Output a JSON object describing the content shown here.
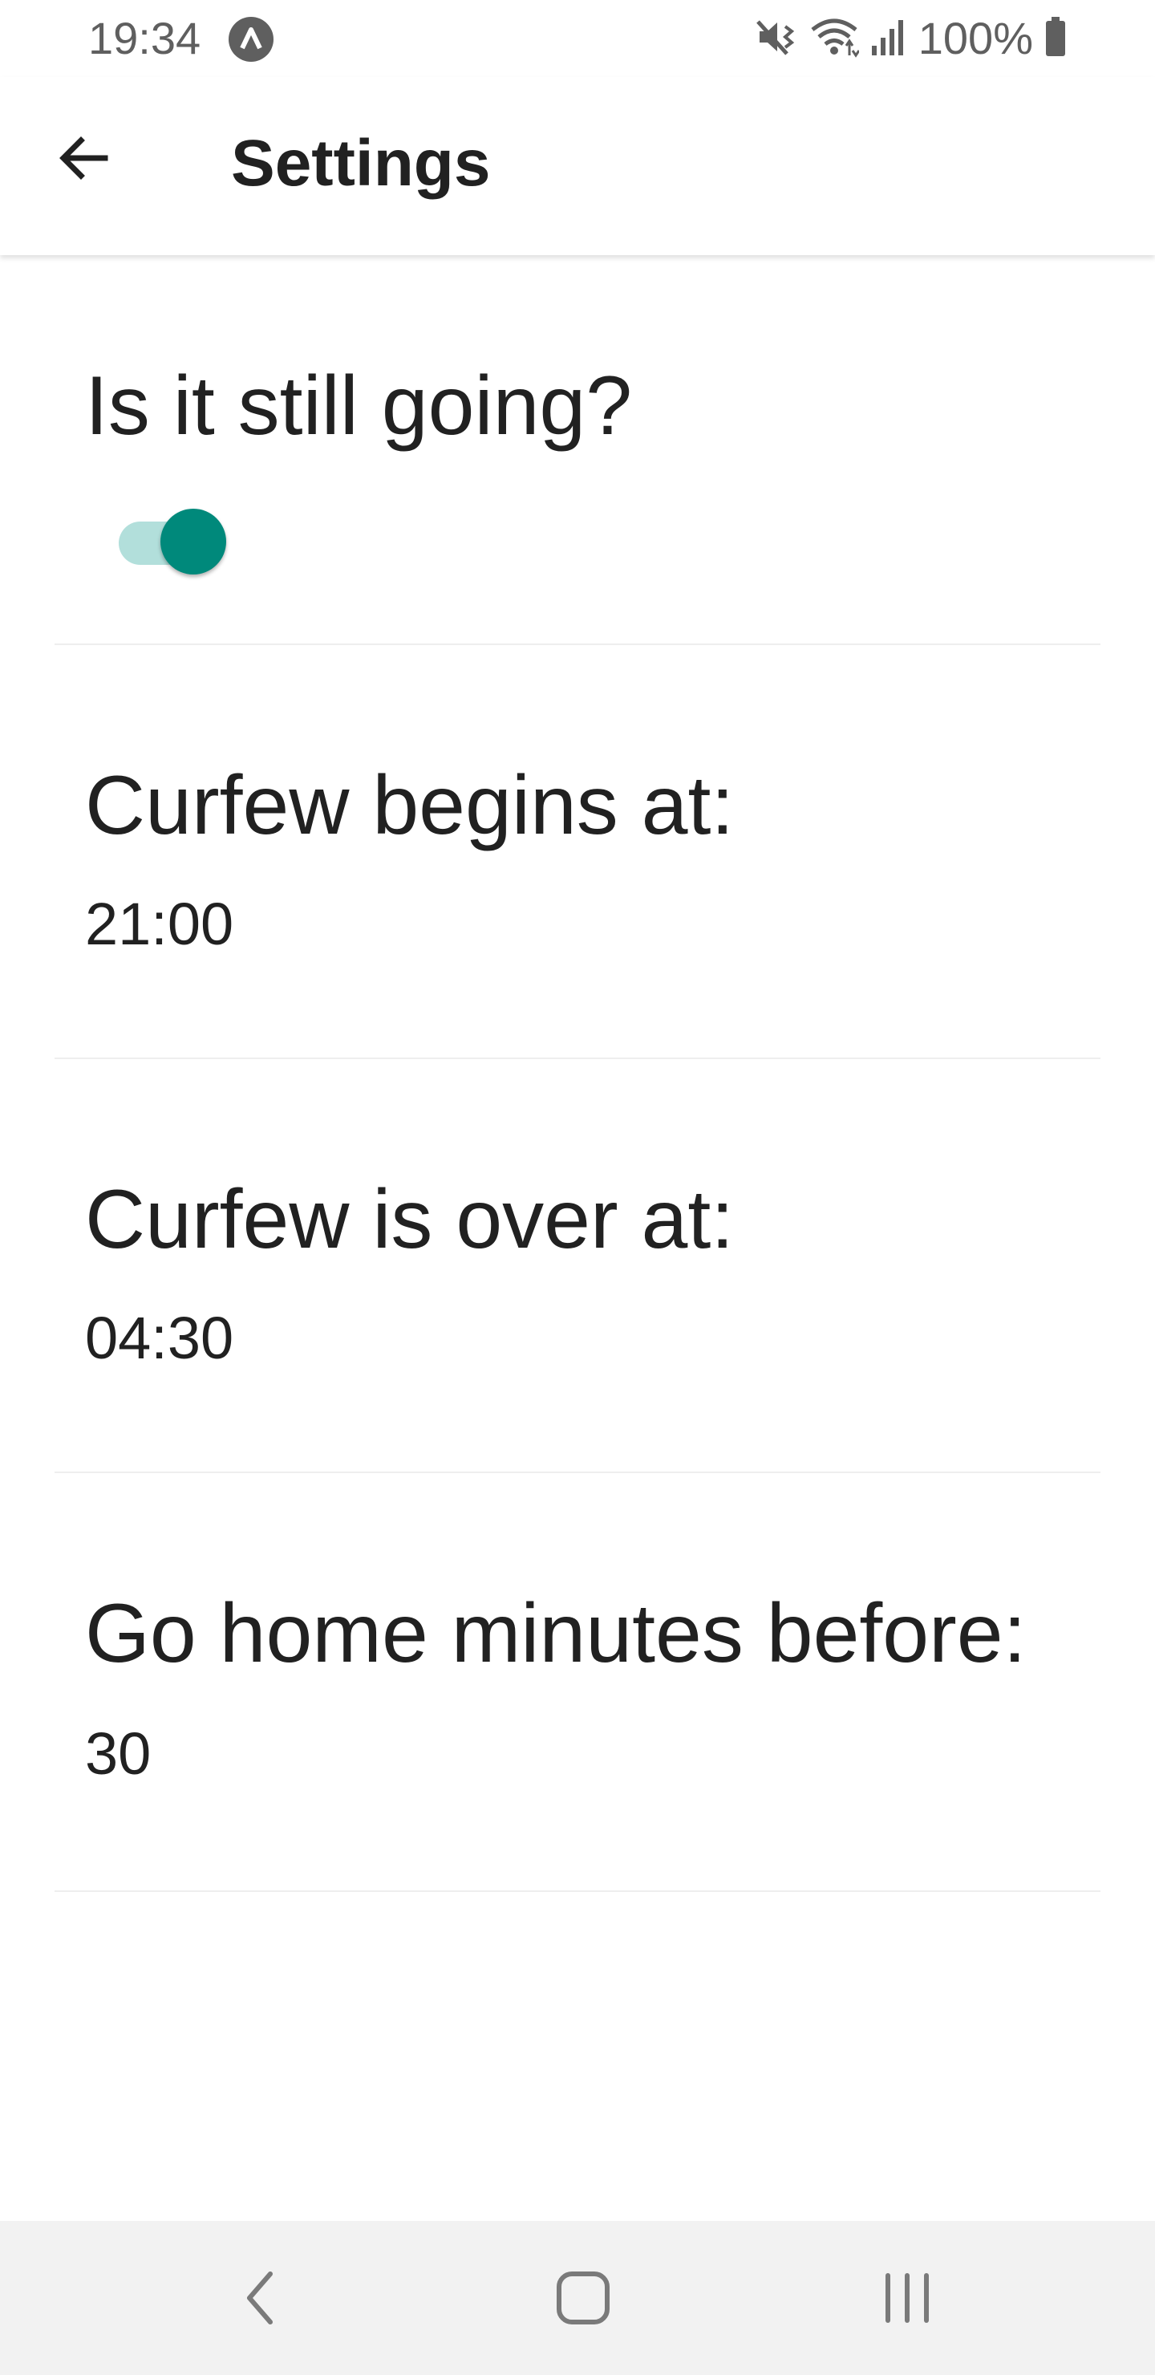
{
  "status_bar": {
    "time": "19:34",
    "battery": "100%",
    "icons": [
      "app-notification-icon",
      "mute-vibrate-icon",
      "wifi-icon",
      "signal-icon",
      "battery-icon"
    ]
  },
  "app_bar": {
    "title": "Settings",
    "back_icon": "arrow-back-icon"
  },
  "settings": {
    "still_going": {
      "label": "Is it still going?",
      "enabled": true
    },
    "curfew_begins": {
      "label": "Curfew begins at:",
      "value": "21:00"
    },
    "curfew_over": {
      "label": "Curfew is over at:",
      "value": "04:30"
    },
    "go_home": {
      "label": "Go home minutes before:",
      "value": "30"
    }
  },
  "colors": {
    "accent": "#00897b",
    "accent_light": "#b2dfdb",
    "text": "#212121",
    "status_text": "#5f5f5f",
    "nav_bar": "#f2f2f2"
  },
  "nav_bar": {
    "buttons": [
      "back-icon",
      "home-icon",
      "recents-icon"
    ]
  }
}
